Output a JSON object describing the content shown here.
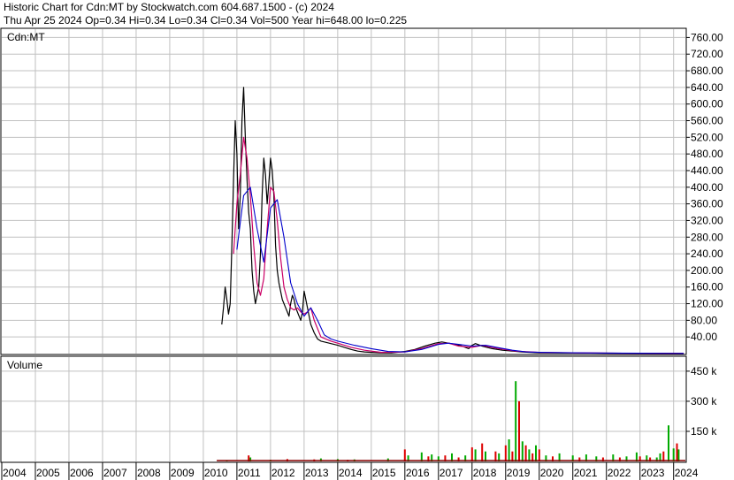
{
  "header": {
    "line1": "Historic Chart for Cdn:MT by Stockwatch.com 604.687.1500 - (c) 2024",
    "line2": "Thu Apr 25 2024  Op=0.34  Hi=0.34  Lo=0.34  Cl=0.34  Vol=500  Year hi=648.00  lo=0.225"
  },
  "colors": {
    "price": "#000000",
    "ma_short": "#cc0066",
    "ma_long": "#0000cc",
    "vol_up": "#00aa00",
    "vol_down": "#dd0000",
    "grid": "#c0c0c0"
  },
  "chart_data": [
    {
      "type": "line",
      "panel_label": "Cdn:MT",
      "ylim": [
        0,
        780
      ],
      "y_ticks": [
        "760.00",
        "720.00",
        "680.00",
        "640.00",
        "600.00",
        "560.00",
        "520.00",
        "480.00",
        "440.00",
        "400.00",
        "360.00",
        "320.00",
        "280.00",
        "240.00",
        "200.00",
        "160.00",
        "120.00",
        "80.00",
        "40.00"
      ],
      "x_ticks": [
        "2004",
        "2005",
        "2006",
        "2007",
        "2008",
        "2009",
        "2010",
        "2011",
        "2012",
        "2013",
        "2014",
        "2015",
        "2016",
        "2017",
        "2018",
        "2019",
        "2020",
        "2021",
        "2022",
        "2023",
        "2024"
      ],
      "xlim": [
        2004.0,
        2024.35
      ],
      "series": [
        {
          "role": "price",
          "x": [
            2010.55,
            2010.6,
            2010.65,
            2010.7,
            2010.75,
            2010.8,
            2010.85,
            2010.9,
            2010.95,
            2011.0,
            2011.05,
            2011.1,
            2011.15,
            2011.2,
            2011.25,
            2011.3,
            2011.35,
            2011.4,
            2011.45,
            2011.5,
            2011.55,
            2011.6,
            2011.65,
            2011.7,
            2011.75,
            2011.8,
            2011.85,
            2011.9,
            2011.95,
            2012.0,
            2012.05,
            2012.1,
            2012.15,
            2012.2,
            2012.25,
            2012.3,
            2012.35,
            2012.4,
            2012.45,
            2012.5,
            2012.55,
            2012.6,
            2012.65,
            2012.7,
            2012.75,
            2012.8,
            2012.85,
            2012.9,
            2012.95,
            2013.0,
            2013.05,
            2013.1,
            2013.15,
            2013.2,
            2013.3,
            2013.4,
            2013.5,
            2013.6,
            2013.8,
            2014.0,
            2014.2,
            2014.4,
            2014.6,
            2014.8,
            2015.0,
            2015.3,
            2015.6,
            2016.0,
            2016.3,
            2016.6,
            2016.9,
            2017.1,
            2017.3,
            2017.5,
            2017.7,
            2017.9,
            2018.0,
            2018.1,
            2018.3,
            2018.6,
            2018.9,
            2019.2,
            2019.5,
            2020.0,
            2021.0,
            2022.0,
            2023.0,
            2024.3
          ],
          "values": [
            70,
            110,
            160,
            130,
            95,
            120,
            260,
            420,
            560,
            480,
            300,
            380,
            560,
            640,
            520,
            420,
            340,
            300,
            200,
            150,
            120,
            140,
            160,
            240,
            380,
            470,
            430,
            360,
            410,
            470,
            440,
            380,
            260,
            200,
            170,
            150,
            130,
            120,
            110,
            100,
            90,
            120,
            140,
            130,
            110,
            100,
            90,
            80,
            100,
            150,
            130,
            110,
            90,
            70,
            50,
            35,
            30,
            28,
            24,
            20,
            15,
            10,
            6,
            4,
            3,
            2,
            2,
            5,
            10,
            18,
            25,
            28,
            25,
            22,
            18,
            12,
            20,
            24,
            18,
            12,
            8,
            6,
            4,
            2,
            1.5,
            1,
            0.6,
            0.34
          ]
        },
        {
          "role": "ma_short",
          "x": [
            2010.9,
            2011.0,
            2011.1,
            2011.2,
            2011.3,
            2011.4,
            2011.5,
            2011.6,
            2011.7,
            2011.8,
            2011.9,
            2012.0,
            2012.1,
            2012.2,
            2012.3,
            2012.4,
            2012.5,
            2012.6,
            2012.7,
            2012.8,
            2012.9,
            2013.0,
            2013.1,
            2013.2,
            2013.3,
            2013.5,
            2013.8,
            2014.0,
            2014.4,
            2014.8,
            2015.3,
            2016.0,
            2016.5,
            2017.0,
            2017.3,
            2017.6,
            2018.0,
            2018.3,
            2018.8,
            2019.3,
            2020.0,
            2021.0,
            2022.0,
            2023.0,
            2024.3
          ],
          "values": [
            240,
            360,
            430,
            520,
            470,
            380,
            260,
            170,
            140,
            180,
            300,
            400,
            390,
            320,
            230,
            160,
            130,
            110,
            105,
            110,
            100,
            95,
            100,
            110,
            80,
            40,
            30,
            25,
            15,
            8,
            3,
            4,
            12,
            24,
            25,
            18,
            15,
            20,
            12,
            6,
            3,
            2,
            1,
            0.7,
            0.4
          ]
        },
        {
          "role": "ma_long",
          "x": [
            2011.0,
            2011.2,
            2011.4,
            2011.6,
            2011.8,
            2012.0,
            2012.2,
            2012.4,
            2012.6,
            2012.8,
            2013.0,
            2013.2,
            2013.4,
            2013.6,
            2013.8,
            2014.0,
            2014.5,
            2015.0,
            2015.5,
            2016.0,
            2016.5,
            2017.0,
            2017.3,
            2017.6,
            2018.0,
            2018.4,
            2018.8,
            2019.2,
            2019.6,
            2020.0,
            2021.0,
            2022.0,
            2023.0,
            2024.3
          ],
          "values": [
            250,
            380,
            400,
            300,
            220,
            350,
            370,
            280,
            170,
            120,
            90,
            110,
            80,
            45,
            35,
            30,
            20,
            12,
            5,
            4,
            10,
            22,
            25,
            22,
            18,
            20,
            14,
            8,
            4,
            3,
            2,
            1.2,
            0.8,
            0.5
          ]
        }
      ]
    },
    {
      "type": "bar",
      "panel_label": "Volume",
      "ylim": [
        0,
        520000
      ],
      "y_ticks": [
        "450 k",
        "300 k",
        "150 k"
      ],
      "series": [
        {
          "role": "volume_up",
          "x": [
            2010.7,
            2011.4,
            2012.0,
            2013.5,
            2014.0,
            2014.5,
            2015.5,
            2016.1,
            2016.5,
            2016.8,
            2017.0,
            2017.4,
            2017.8,
            2018.1,
            2018.4,
            2018.8,
            2019.1,
            2019.3,
            2019.5,
            2019.7,
            2019.9,
            2020.2,
            2020.6,
            2021.0,
            2021.4,
            2021.7,
            2022.2,
            2022.6,
            2022.9,
            2023.2,
            2023.5,
            2023.6,
            2023.85,
            2024.0,
            2024.15
          ],
          "values": [
            6000,
            20000,
            8000,
            15000,
            12000,
            10000,
            15000,
            30000,
            45000,
            35000,
            25000,
            40000,
            30000,
            60000,
            50000,
            40000,
            110000,
            400000,
            100000,
            60000,
            80000,
            30000,
            40000,
            30000,
            35000,
            25000,
            35000,
            25000,
            45000,
            30000,
            20000,
            40000,
            180000,
            65000,
            60000
          ]
        },
        {
          "role": "volume_down",
          "x": [
            2011.35,
            2012.5,
            2013.3,
            2014.3,
            2016.0,
            2016.7,
            2017.2,
            2017.6,
            2018.0,
            2018.3,
            2018.7,
            2019.0,
            2019.2,
            2019.4,
            2019.6,
            2019.8,
            2020.0,
            2020.4,
            2021.2,
            2021.9,
            2022.4,
            2023.0,
            2023.3,
            2023.7,
            2024.1
          ],
          "values": [
            30000,
            12000,
            10000,
            8000,
            60000,
            25000,
            30000,
            20000,
            70000,
            90000,
            50000,
            80000,
            50000,
            300000,
            80000,
            40000,
            60000,
            25000,
            20000,
            20000,
            20000,
            25000,
            20000,
            50000,
            90000
          ]
        }
      ]
    }
  ]
}
